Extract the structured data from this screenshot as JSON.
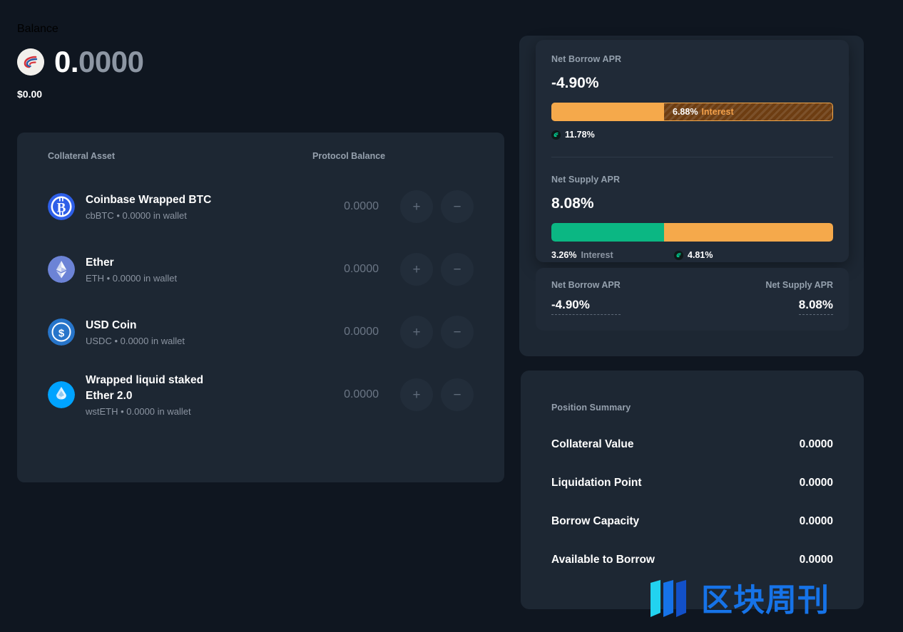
{
  "balance": {
    "label": "Balance",
    "amount_lead": "0.",
    "amount_rest": "0000",
    "fiat": "$0.00",
    "coin_icon": "compound-logo-icon"
  },
  "collateral": {
    "header_asset": "Collateral Asset",
    "header_balance": "Protocol Balance",
    "add_label": "+",
    "remove_label": "−",
    "rows": [
      {
        "name": "Coinbase Wrapped BTC",
        "sub": "cbBTC • 0.0000 in wallet",
        "balance": "0.0000",
        "icon": "bitcoin-icon",
        "color": "#2e5fe8"
      },
      {
        "name": "Ether",
        "sub": "ETH • 0.0000 in wallet",
        "balance": "0.0000",
        "icon": "ethereum-icon",
        "color": "#6c83d6"
      },
      {
        "name": "USD Coin",
        "sub": "USDC • 0.0000 in wallet",
        "balance": "0.0000",
        "icon": "usdc-icon",
        "color": "#2775ca"
      },
      {
        "name": "Wrapped liquid staked Ether 2.0",
        "sub": "wstETH • 0.0000 in wallet",
        "balance": "0.0000",
        "icon": "lido-icon",
        "color": "#00a3ff"
      }
    ]
  },
  "apr_popover": {
    "borrow": {
      "title": "Net Borrow APR",
      "value": "-4.90%",
      "bar": {
        "solid_pct": 40,
        "hatch_pct": 60,
        "hatch_value": "6.88%",
        "hatch_label": "Interest"
      },
      "legend": [
        {
          "icon": "comp-token-icon",
          "value": "11.78%",
          "note": ""
        }
      ]
    },
    "supply": {
      "title": "Net Supply APR",
      "value": "8.08%",
      "bar": {
        "green_pct": 40,
        "orange_pct": 60
      },
      "legend": [
        {
          "icon": "",
          "value": "3.26%",
          "note": "Interest"
        },
        {
          "icon": "comp-token-icon",
          "value": "4.81%",
          "note": ""
        }
      ]
    }
  },
  "apr_mini": {
    "borrow_label": "Net Borrow APR",
    "borrow_value": "-4.90%",
    "supply_label": "Net Supply APR",
    "supply_value": "8.08%"
  },
  "position_summary": {
    "title": "Position Summary",
    "rows": [
      {
        "label": "Collateral Value",
        "value": "0.0000"
      },
      {
        "label": "Liquidation Point",
        "value": "0.0000"
      },
      {
        "label": "Borrow Capacity",
        "value": "0.0000"
      },
      {
        "label": "Available to Borrow",
        "value": "0.0000"
      }
    ]
  },
  "watermark": {
    "text": "区块周刊",
    "logo_icon": "bars-logo-icon"
  },
  "colors": {
    "accent_green": "#00b871",
    "orange": "#f5a94b",
    "teal": "#0bb783",
    "hatch_brown": "#6d3d12",
    "card_bg": "#1d2733",
    "popover_bg": "#202a37",
    "page_bg": "#0f1620",
    "watermark_blue": "#1673e8"
  }
}
